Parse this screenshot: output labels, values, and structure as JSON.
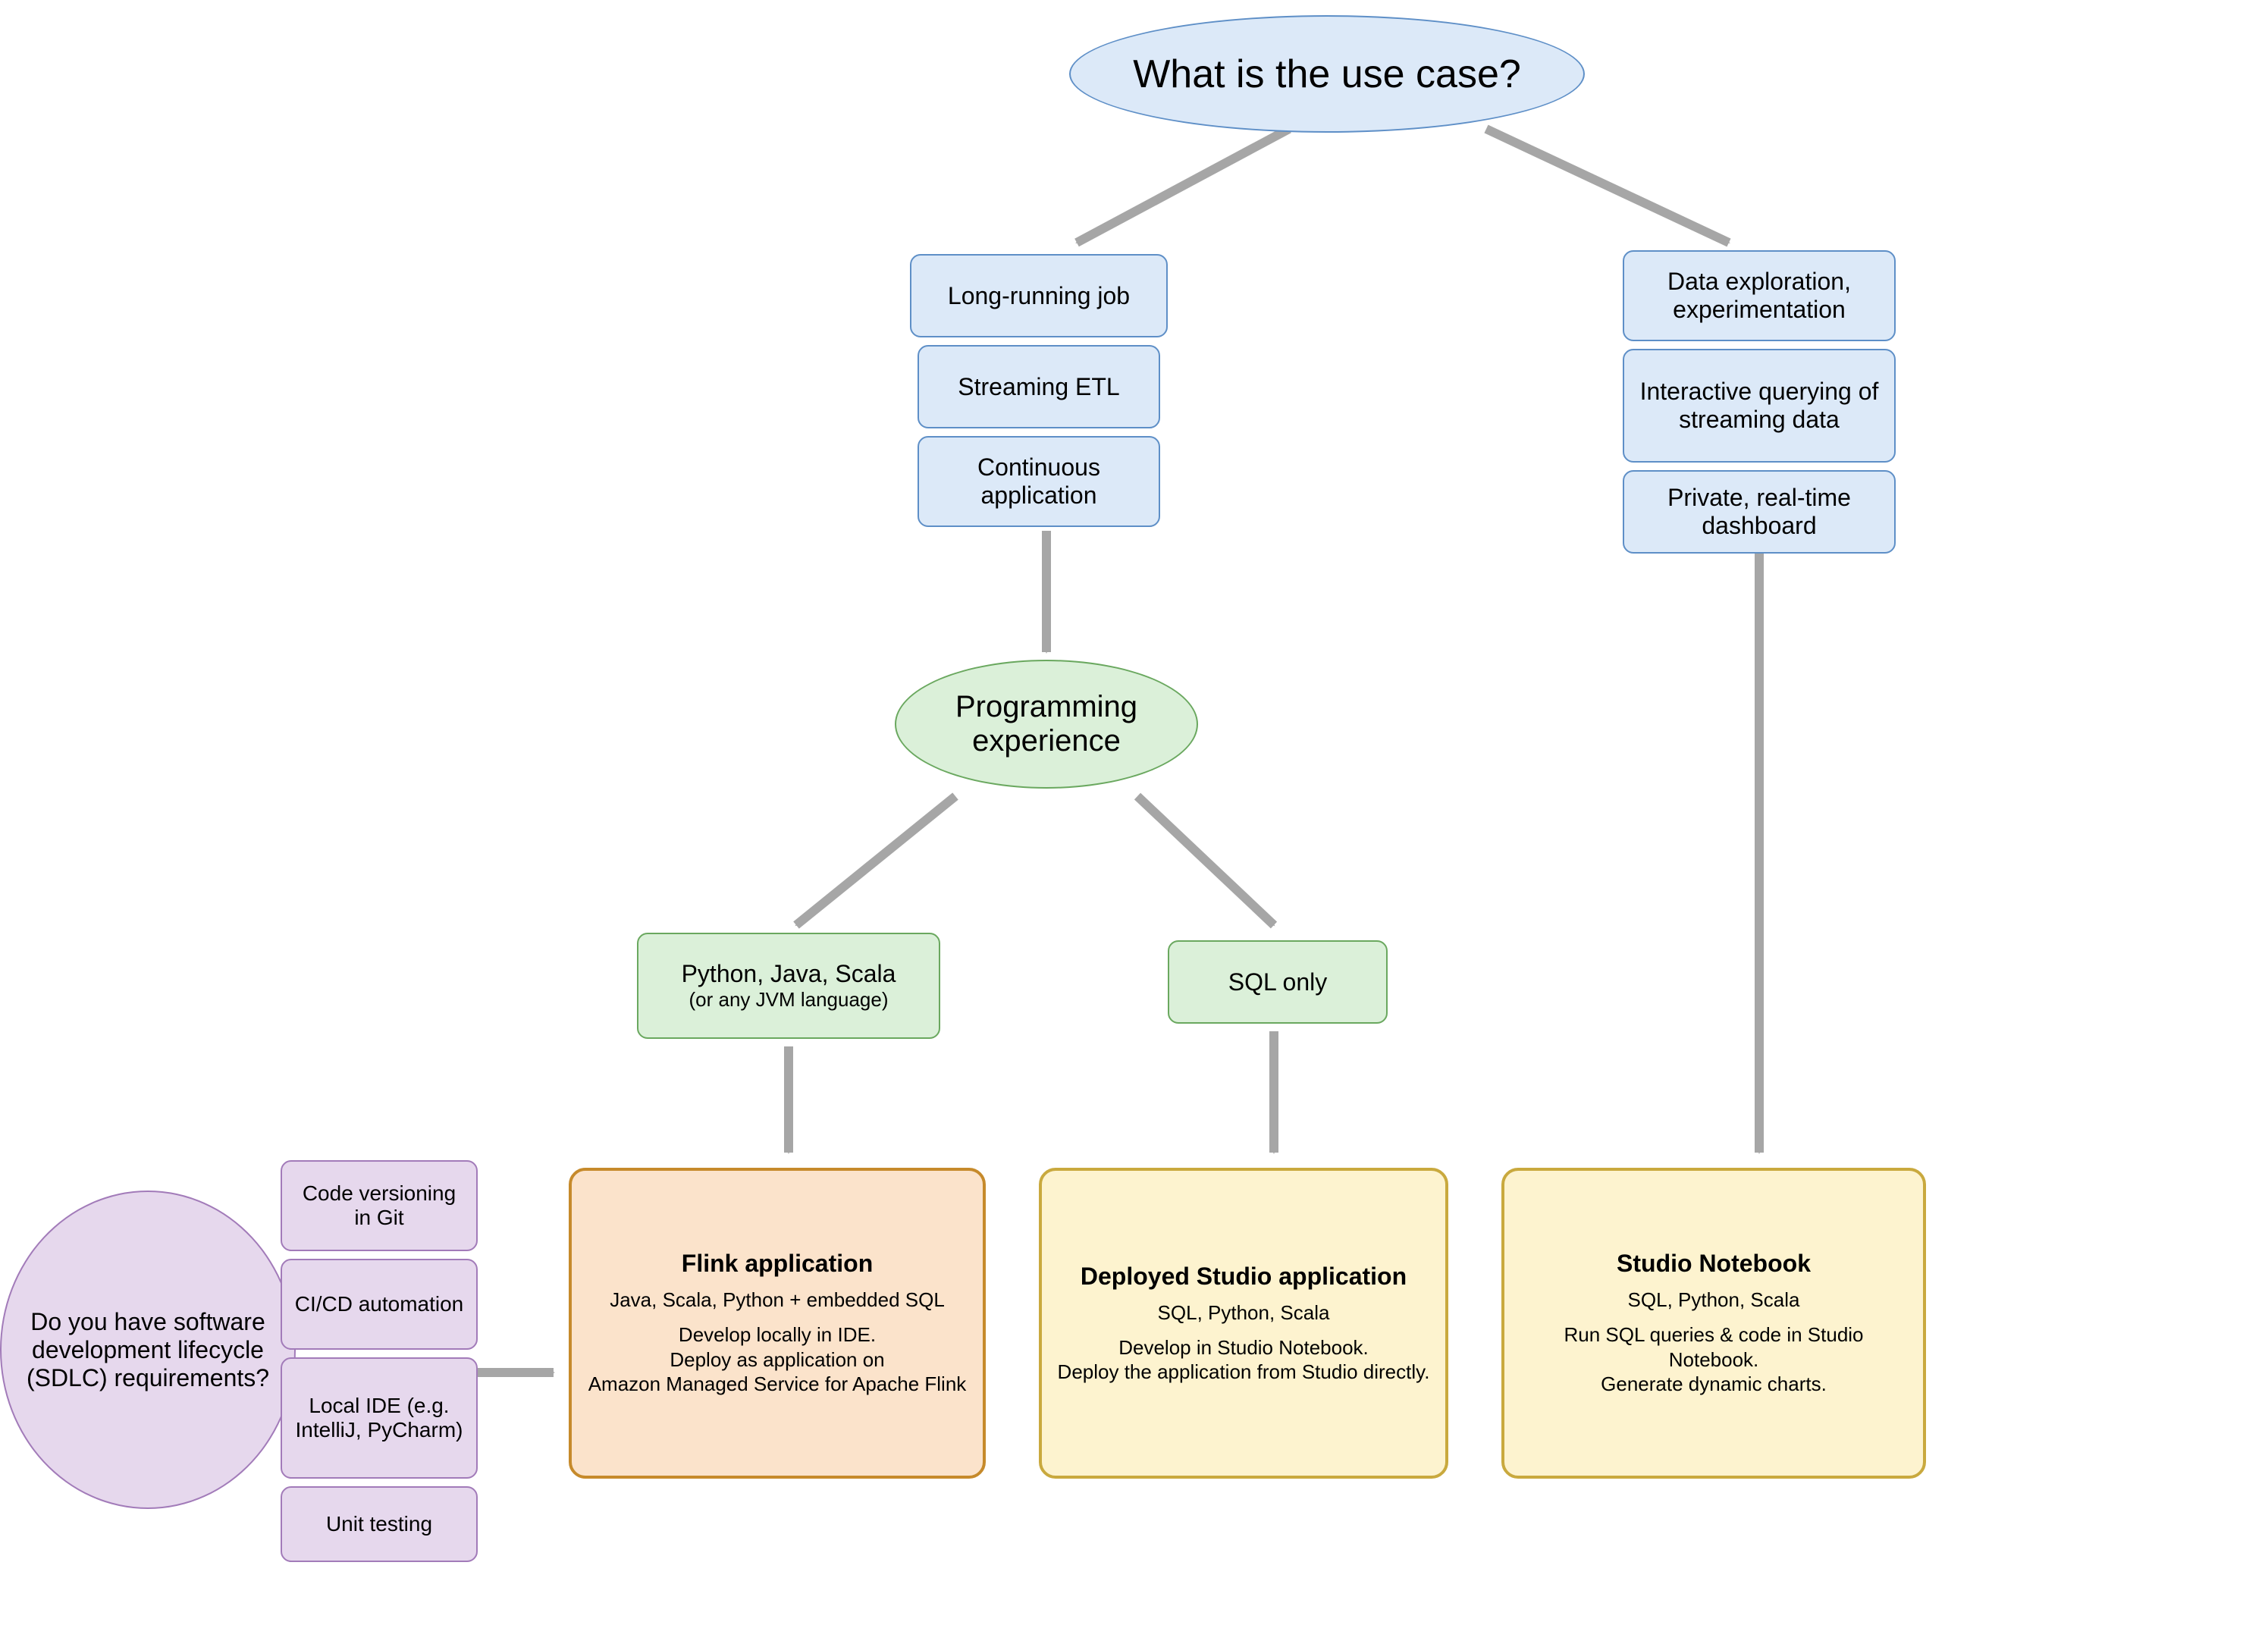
{
  "root": {
    "label": "What is the use case?"
  },
  "left_stack": {
    "a": "Long-running job",
    "b": "Streaming ETL",
    "c": "Continuous application"
  },
  "right_stack": {
    "a": "Data exploration, experimentation",
    "b": "Interactive querying of streaming data",
    "c": "Private, real-time dashboard"
  },
  "prog_exp": {
    "label": "Programming experience"
  },
  "lang_left": {
    "main": "Python, Java, Scala",
    "sub": "(or any JVM language)"
  },
  "lang_right": {
    "label": "SQL only"
  },
  "sdlc": {
    "label": "Do you have software development lifecycle (SDLC) requirements?"
  },
  "sdlc_items": {
    "a": "Code versioning in Git",
    "b": "CI/CD automation",
    "c": "Local IDE (e.g. IntelliJ, PyCharm)",
    "d": "Unit testing"
  },
  "result_flink": {
    "title": "Flink application",
    "sub": "Java, Scala, Python + embedded SQL",
    "desc": "Develop locally in IDE.\nDeploy as application on\nAmazon Managed Service for Apache Flink"
  },
  "result_deployed": {
    "title": "Deployed Studio application",
    "sub": "SQL, Python, Scala",
    "desc": "Develop in Studio Notebook.\nDeploy the application from Studio directly."
  },
  "result_notebook": {
    "title": "Studio Notebook",
    "sub": "SQL, Python, Scala",
    "desc": "Run SQL queries & code in Studio Notebook.\nGenerate dynamic charts."
  }
}
